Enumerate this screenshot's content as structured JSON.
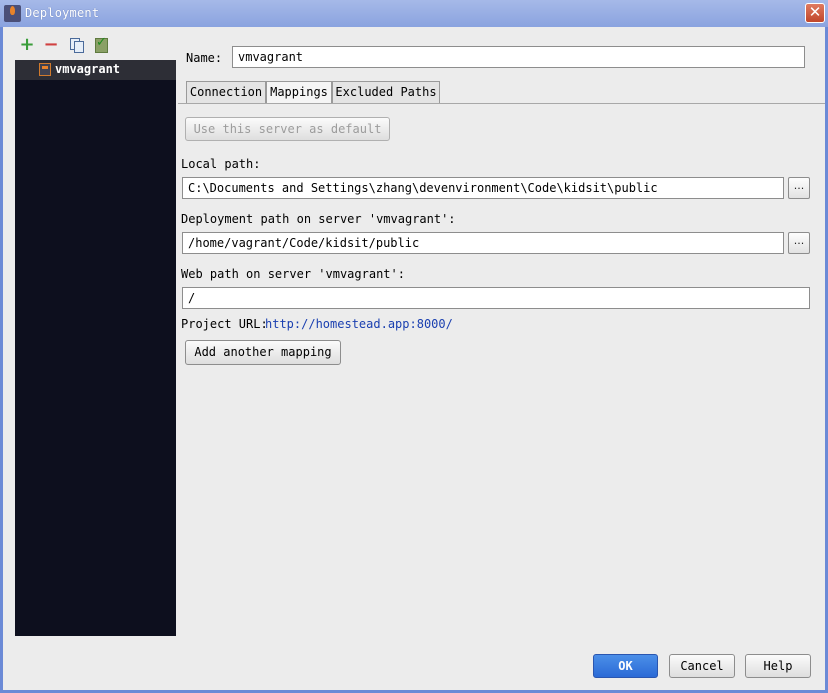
{
  "window": {
    "title": "Deployment",
    "close_label": "✕"
  },
  "toolbar": {
    "add_label": "+",
    "remove_label": "−",
    "icons": [
      "add-icon",
      "remove-icon",
      "copy-icon",
      "use-as-default-icon"
    ]
  },
  "servers": [
    {
      "name": "vmvagrant",
      "selected": true
    }
  ],
  "name_field": {
    "label": "Name:",
    "value": "vmvagrant"
  },
  "tabs": [
    {
      "label": "Connection",
      "active": false
    },
    {
      "label": "Mappings",
      "active": true
    },
    {
      "label": "Excluded Paths",
      "active": false
    }
  ],
  "mappings": {
    "default_button": "Use this server as default",
    "local_path_label": "Local path:",
    "local_path_value": "C:\\Documents and Settings\\zhang\\devenvironment\\Code\\kidsit\\public",
    "deployment_path_label": "Deployment path on server 'vmvagrant':",
    "deployment_path_value": "/home/vagrant/Code/kidsit/public",
    "web_path_label": "Web path on server 'vmvagrant':",
    "web_path_value": "/",
    "project_url_label": "Project URL:",
    "project_url_value": "http://homestead.app:8000/",
    "add_mapping_button": "Add another mapping",
    "browse_label": "..."
  },
  "footer": {
    "ok_label": "OK",
    "cancel_label": "Cancel",
    "help_label": "Help"
  },
  "colors": {
    "tree_background": "#0d0f1e",
    "selected_item": "#2d2e36",
    "ok_button": "#2b6ad6",
    "link": "#1a3fb0"
  }
}
